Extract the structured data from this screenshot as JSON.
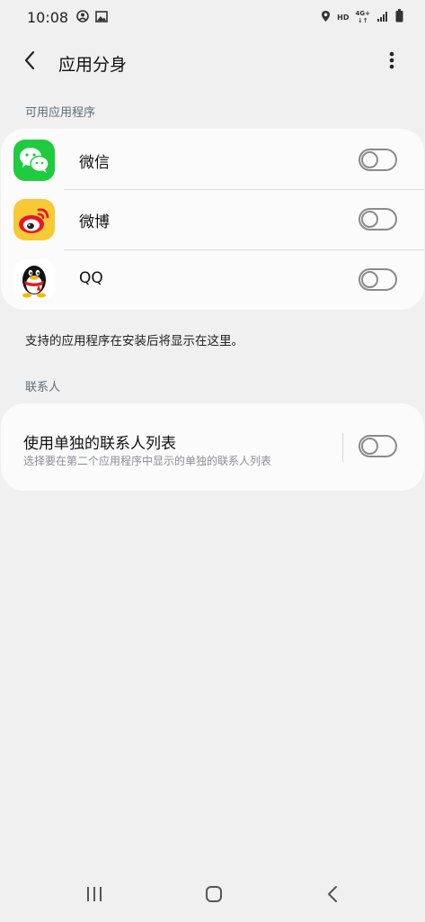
{
  "status_bar": {
    "time": "10:08",
    "network_hd": "HD",
    "network_4g": "4G+"
  },
  "header": {
    "title": "应用分身"
  },
  "sections": {
    "available_apps": "可用应用程序",
    "contacts": "联系人"
  },
  "apps": [
    {
      "name": "微信",
      "icon": "wechat-icon",
      "color": "#1fcb3f",
      "enabled": false
    },
    {
      "name": "微博",
      "icon": "weibo-icon",
      "color": "#f6c935",
      "enabled": false
    },
    {
      "name": "QQ",
      "icon": "qq-icon",
      "color": "#111111",
      "enabled": false
    }
  ],
  "info_text": "支持的应用程序在安装后将显示在这里。",
  "contacts_setting": {
    "title": "使用单独的联系人列表",
    "subtitle": "选择要在第二个应用程序中显示的单独的联系人列表",
    "enabled": false
  },
  "nav": {
    "recents": "recents-icon",
    "home": "home-icon",
    "back": "back-icon"
  }
}
